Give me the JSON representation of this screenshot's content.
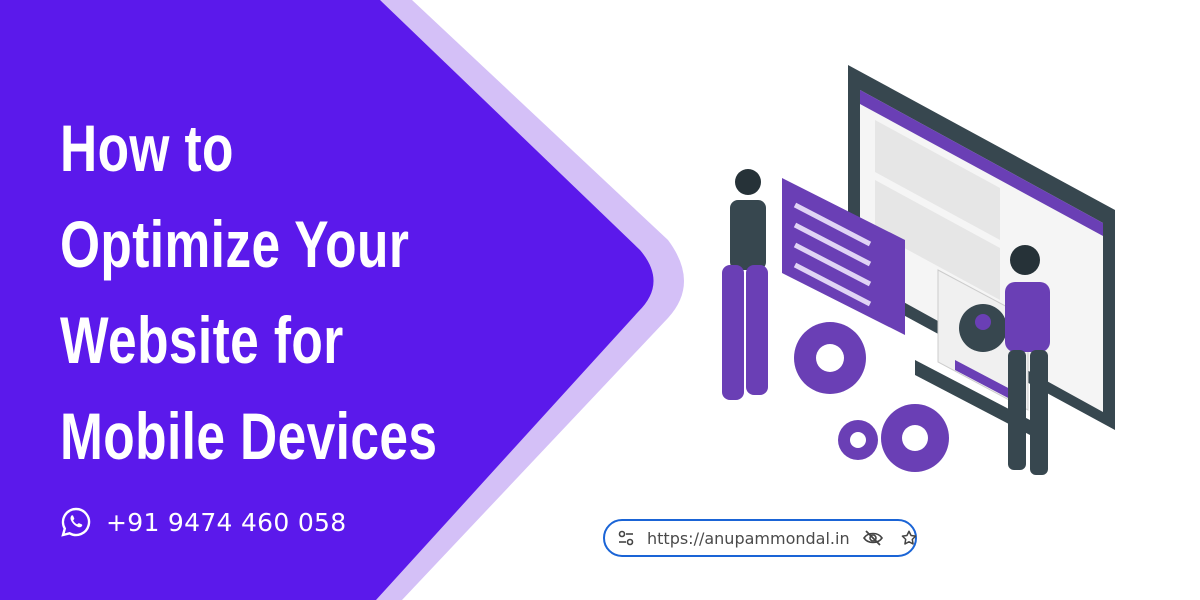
{
  "banner": {
    "title_lines": [
      "How to",
      "Optimize Your",
      "Website for",
      "Mobile Devices"
    ],
    "phone": "+91 9474 460 058",
    "phone_icon": "whatsapp-icon"
  },
  "address_bar": {
    "url": "https://anupammondal.in",
    "icons": [
      "site-settings-icon",
      "eye-off-icon",
      "star-icon"
    ],
    "border_color": "#1a64d6"
  },
  "colors": {
    "primary": "#5b19eb",
    "accent_light": "#d4c0f7",
    "text": "#ffffff"
  }
}
